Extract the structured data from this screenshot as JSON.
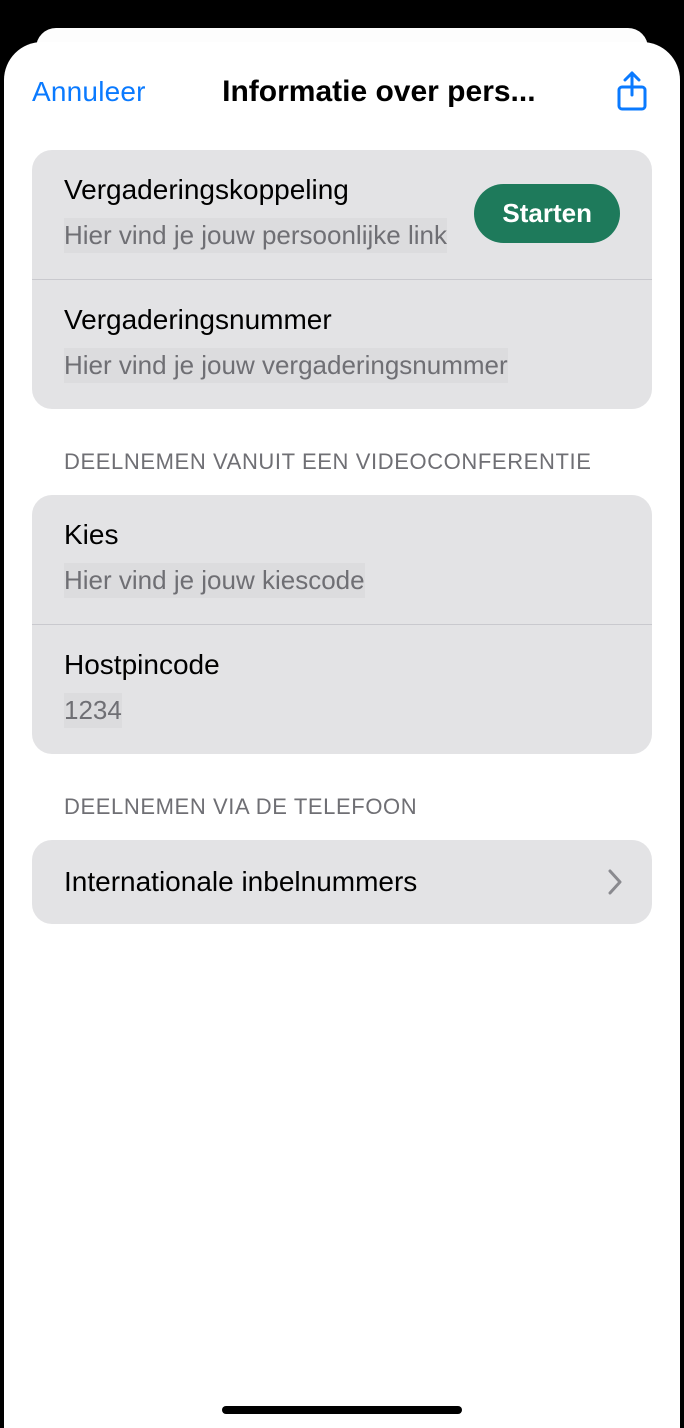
{
  "nav": {
    "cancel": "Annuleer",
    "title": "Informatie over pers...",
    "share_icon": "share-icon"
  },
  "s1": {
    "r1": {
      "title": "Vergaderingskoppeling",
      "sub": "Hier vind je jouw persoonlijke link",
      "btn": "Starten"
    },
    "r2": {
      "title": "Vergaderingsnummer",
      "sub": "Hier vind je jouw vergaderingsnummer"
    }
  },
  "s2": {
    "header": "DEELNEMEN VANUIT EEN VIDEOCONFERENTIE",
    "r1": {
      "title": "Kies",
      "sub": "Hier vind je jouw kiescode"
    },
    "r2": {
      "title": "Hostpincode",
      "sub": "1234"
    }
  },
  "s3": {
    "header": "DEELNEMEN VIA DE TELEFOON",
    "r1": {
      "title": "Internationale inbelnummers"
    }
  }
}
